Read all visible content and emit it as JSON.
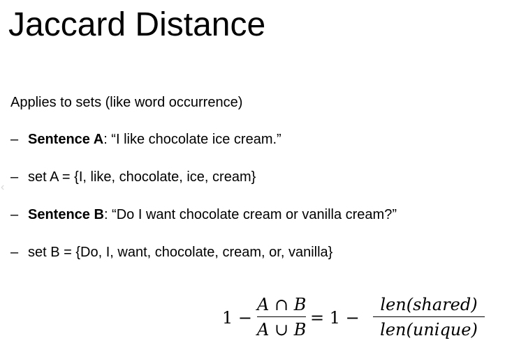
{
  "slide": {
    "title": "Jaccard Distance",
    "intro": "Applies to sets (like word occurrence)",
    "bullets": [
      {
        "dash": "–",
        "bold": "Sentence A",
        "rest": ": “I like chocolate ice cream.”"
      },
      {
        "dash": "–",
        "bold": "",
        "rest": "set A = {I, like, chocolate, ice, cream}"
      },
      {
        "dash": "–",
        "bold": "Sentence B",
        "rest": ": “Do I want chocolate cream or vanilla cream?”"
      },
      {
        "dash": "–",
        "bold": "",
        "rest": "set B = {Do, I, want, chocolate, cream, or, vanilla}"
      }
    ],
    "side_chevron": "‹"
  },
  "formula": {
    "one_minus_left": "1 −",
    "frac1_num": "A ∩ B",
    "frac1_den": "A ∪ B",
    "equals_one_minus": "= 1  −",
    "frac2_num": "len(shared)",
    "frac2_den": "len(unique)"
  }
}
